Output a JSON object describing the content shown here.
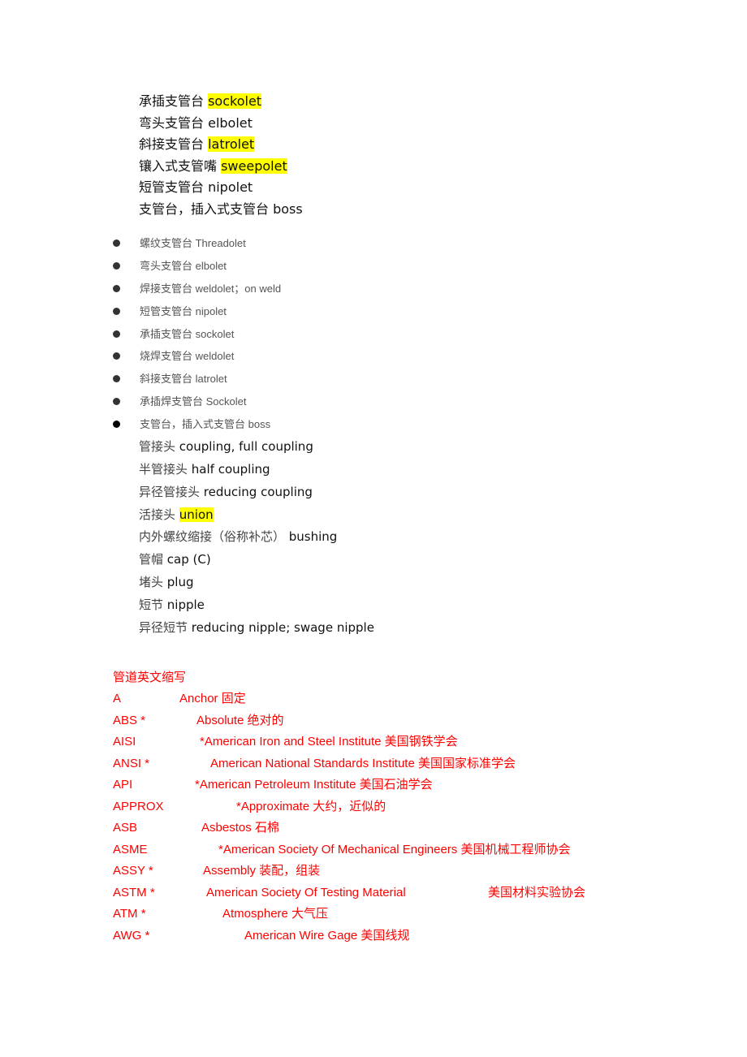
{
  "section1": [
    {
      "zh": "承插支管台 ",
      "en": "sockolet",
      "highlight": true
    },
    {
      "zh": "弯头支管台 ",
      "en": "elbolet",
      "highlight": false
    },
    {
      "zh": "斜接支管台 ",
      "en": "latrolet",
      "highlight": true
    },
    {
      "zh": "镶入式支管嘴 ",
      "en": "sweepolet",
      "highlight": true
    },
    {
      "zh": "短管支管台 ",
      "en": "nipolet",
      "highlight": false
    },
    {
      "zh": "支管台，插入式支管台 ",
      "en": "boss",
      "highlight": false
    }
  ],
  "bullets": [
    "螺纹支管台 Threadolet",
    "弯头支管台 elbolet",
    "焊接支管台 weldolet；on weld",
    "短管支管台 nipolet",
    "承插支管台 sockolet",
    "烧焊支管台 weldolet",
    "斜接支管台 latrolet",
    "承插焊支管台 Sockolet",
    "支管台，插入式支管台 boss"
  ],
  "section2": [
    {
      "zh": "管接头 ",
      "en": "coupling, full coupling",
      "highlight": false
    },
    {
      "zh": "半管接头 ",
      "en": "half coupling",
      "highlight": false
    },
    {
      "zh": "异径管接头 ",
      "en": "reducing coupling",
      "highlight": false
    },
    {
      "zh": "活接头 ",
      "en": "union",
      "highlight": true
    },
    {
      "zh": "内外螺纹缩接（俗称补芯） ",
      "en": "bushing",
      "highlight": false
    },
    {
      "zh": "管帽 ",
      "en": "cap (C)",
      "highlight": false
    },
    {
      "zh": "堵头 ",
      "en": "plug",
      "highlight": false
    },
    {
      "zh": "短节 ",
      "en": "nipple",
      "highlight": false
    },
    {
      "zh": "异径短节 ",
      "en": "reducing nipple; swage nipple",
      "highlight": false
    }
  ],
  "abbrev": {
    "title": "管道英文缩写",
    "rows": [
      {
        "abbr": "A",
        "desc": "Anchor 固定"
      },
      {
        "abbr": "ABS *",
        "desc": "Absolute 绝对的"
      },
      {
        "abbr": "AISI",
        "desc": "*American Iron and  Steel  Institute   美国钢铁学会"
      },
      {
        "abbr": "ANSI *",
        "desc": "American National  Standards Institute 美国国家标准学会"
      },
      {
        "abbr": "API",
        "desc": "*American Petroleum Institute 美国石油学会"
      },
      {
        "abbr": "APPROX",
        "desc": "*Approximate 大约，近似的"
      },
      {
        "abbr": "ASB",
        "desc": "Asbestos 石棉"
      },
      {
        "abbr": "ASME",
        "desc": "*American Society Of Mechanical Engineers 美国机械工程师协会"
      },
      {
        "abbr": "ASSY *",
        "desc": "Assembly 装配，组装"
      },
      {
        "abbr": "ASTM *",
        "desc": "American Society Of  Testing Material",
        "extra": "美国材料实验协会"
      },
      {
        "abbr": "ATM *",
        "desc": "Atmosphere 大气压"
      },
      {
        "abbr": "AWG *",
        "desc": "American Wire Gage 美国线规"
      }
    ]
  },
  "colors": {
    "highlight": "#ffff00",
    "abbrev_text": "#ff0000"
  }
}
